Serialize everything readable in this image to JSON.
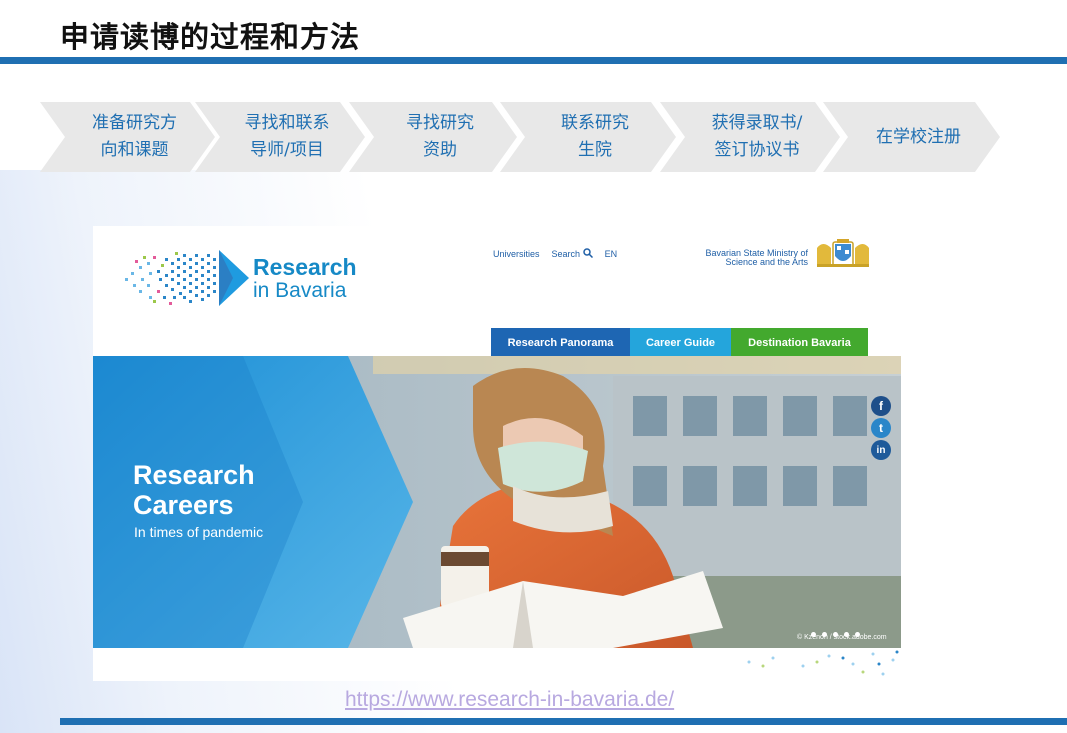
{
  "slide": {
    "title": "申请读博的过程和方法",
    "url": "https://www.research-in-bavaria.de/"
  },
  "steps": [
    {
      "label": "准备研究方\n向和课题"
    },
    {
      "label": "寻找和联系\n导师/项目"
    },
    {
      "label": "寻找研究\n资助"
    },
    {
      "label": "联系研究\n生院"
    },
    {
      "label": "获得录取书/\n签订协议书"
    },
    {
      "label": "在学校注册"
    }
  ],
  "website": {
    "logo_line1": "Research",
    "logo_line2": "in Bavaria",
    "nav": {
      "universities": "Universities",
      "search": "Search",
      "lang": "EN"
    },
    "ministry_line1": "Bavarian State Ministry of",
    "ministry_line2": "Science and the Arts",
    "tabs": [
      {
        "label": "Research Panorama",
        "color": "#1e66b3"
      },
      {
        "label": "Career Guide",
        "color": "#24a5dc"
      },
      {
        "label": "Destination Bavaria",
        "color": "#43a92e"
      }
    ],
    "hero": {
      "title_line1": "Research",
      "title_line2": "Careers",
      "subtitle": "In times of pandemic",
      "credit": "© Kzenon / stock.adobe.com"
    },
    "social": [
      {
        "icon": "facebook-icon",
        "glyph": "f",
        "color": "#1e4f8a"
      },
      {
        "icon": "twitter-icon",
        "glyph": "t",
        "color": "#2a86c9"
      },
      {
        "icon": "linkedin-icon",
        "glyph": "in",
        "color": "#1e5a9a"
      }
    ]
  },
  "colors": {
    "accent": "#1f6fb2",
    "step_text": "#1f6fb2",
    "step_bg": "#e8e8e8"
  }
}
